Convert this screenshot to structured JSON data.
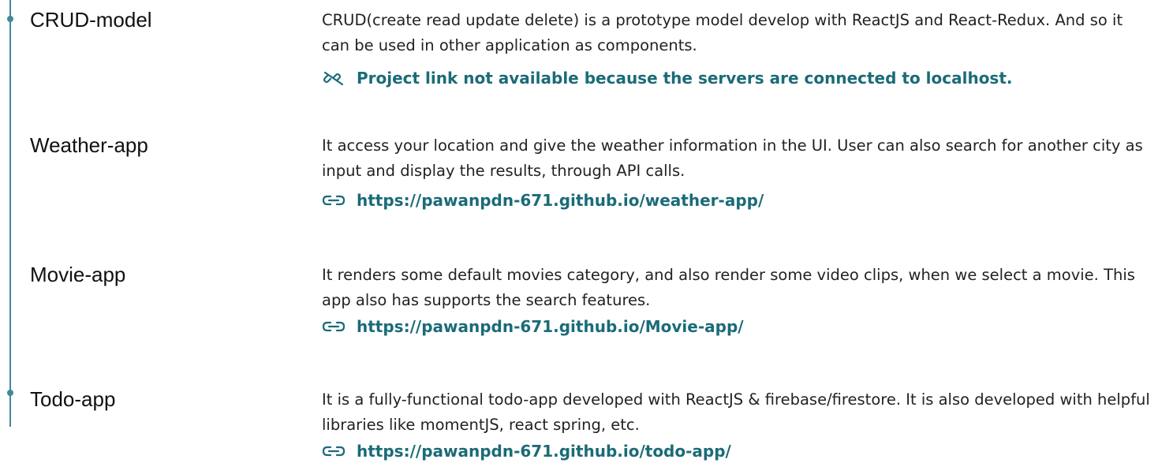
{
  "colors": {
    "accent": "#3e8b95",
    "link": "#1b6b78",
    "heading": "#111111",
    "text": "#222222"
  },
  "projects": [
    {
      "name": "CRUD-model",
      "description": "CRUD(create read update delete) is a prototype model develop with ReactJS and React-Redux. And so it can be used in other application as components.",
      "link_text": "Project link not available because the servers are connected to localhost.",
      "icon": "link-off-icon"
    },
    {
      "name": "Weather-app",
      "description": "It access your location and give the weather information in the UI. User can also search for another city as input and display the results, through API calls.",
      "link_text": "https://pawanpdn-671.github.io/weather-app/",
      "icon": "link-icon"
    },
    {
      "name": "Movie-app",
      "description": "It renders some default movies category, and also render some video clips, when we select a movie. This app also has supports the search features.",
      "link_text": "https://pawanpdn-671.github.io/Movie-app/",
      "icon": "link-icon"
    },
    {
      "name": "Todo-app",
      "description": "It is a fully-functional todo-app developed with ReactJS & firebase/firestore. It is also developed with helpful libraries like momentJS, react spring, etc.",
      "link_text": "https://pawanpdn-671.github.io/todo-app/",
      "icon": "link-icon"
    }
  ]
}
